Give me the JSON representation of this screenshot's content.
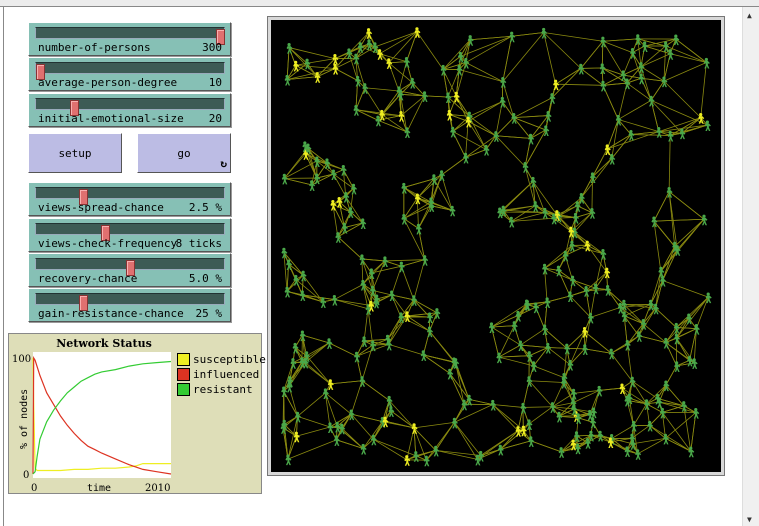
{
  "sliders": [
    {
      "label": "number-of-persons",
      "value": "300",
      "fraction": 1.0
    },
    {
      "label": "average-person-degree",
      "value": "10",
      "fraction": 0.0
    },
    {
      "label": "initial-emotional-size",
      "value": "20",
      "fraction": 0.19
    },
    {
      "label": "views-spread-chance",
      "value": "2.5 %",
      "fraction": 0.24
    },
    {
      "label": "views-check-frequency",
      "value": "8 ticks",
      "fraction": 0.36
    },
    {
      "label": "recovery-chance",
      "value": "5.0 %",
      "fraction": 0.5
    },
    {
      "label": "gain-resistance-chance",
      "value": "25 %",
      "fraction": 0.24
    }
  ],
  "buttons": {
    "setup": "setup",
    "go": "go",
    "go_forever_icon": "↻"
  },
  "scroll": {
    "up": "▲",
    "down": "▼"
  },
  "colors": {
    "susceptible": "#eeee22",
    "influenced": "#dd3322",
    "resistant": "#33cc33",
    "link": "#8a8a10"
  },
  "chart_data": {
    "type": "line",
    "title": "Network Status",
    "xlabel": "time",
    "ylabel": "% of nodes",
    "xlim": [
      0,
      2010
    ],
    "ylim": [
      0,
      100
    ],
    "xticks": [
      "0",
      "2010"
    ],
    "yticks": [
      "100",
      "0"
    ],
    "legend_position": "right",
    "series": [
      {
        "name": "susceptible",
        "color": "#eeee22",
        "x": [
          0,
          10,
          30,
          60,
          200,
          400,
          600,
          800,
          1000,
          1200,
          1400,
          1500,
          1600,
          1800,
          2010
        ],
        "y": [
          100,
          60,
          5,
          3,
          3,
          3,
          4,
          4,
          5,
          5,
          6,
          7,
          9,
          9,
          9
        ]
      },
      {
        "name": "influenced",
        "color": "#dd3322",
        "x": [
          0,
          10,
          30,
          100,
          200,
          300,
          400,
          500,
          600,
          700,
          800,
          900,
          1000,
          1200,
          1400,
          1600,
          1800,
          2010
        ],
        "y": [
          0,
          100,
          98,
          85,
          70,
          60,
          50,
          42,
          35,
          29,
          24,
          21,
          18,
          13,
          8,
          4,
          2,
          0
        ]
      },
      {
        "name": "resistant",
        "color": "#33cc33",
        "x": [
          0,
          30,
          60,
          100,
          200,
          300,
          400,
          500,
          600,
          700,
          800,
          900,
          1000,
          1200,
          1400,
          1600,
          1800,
          2010
        ],
        "y": [
          0,
          2,
          15,
          30,
          45,
          55,
          63,
          70,
          75,
          80,
          83,
          86,
          88,
          90,
          93,
          95,
          96,
          97
        ]
      }
    ]
  }
}
